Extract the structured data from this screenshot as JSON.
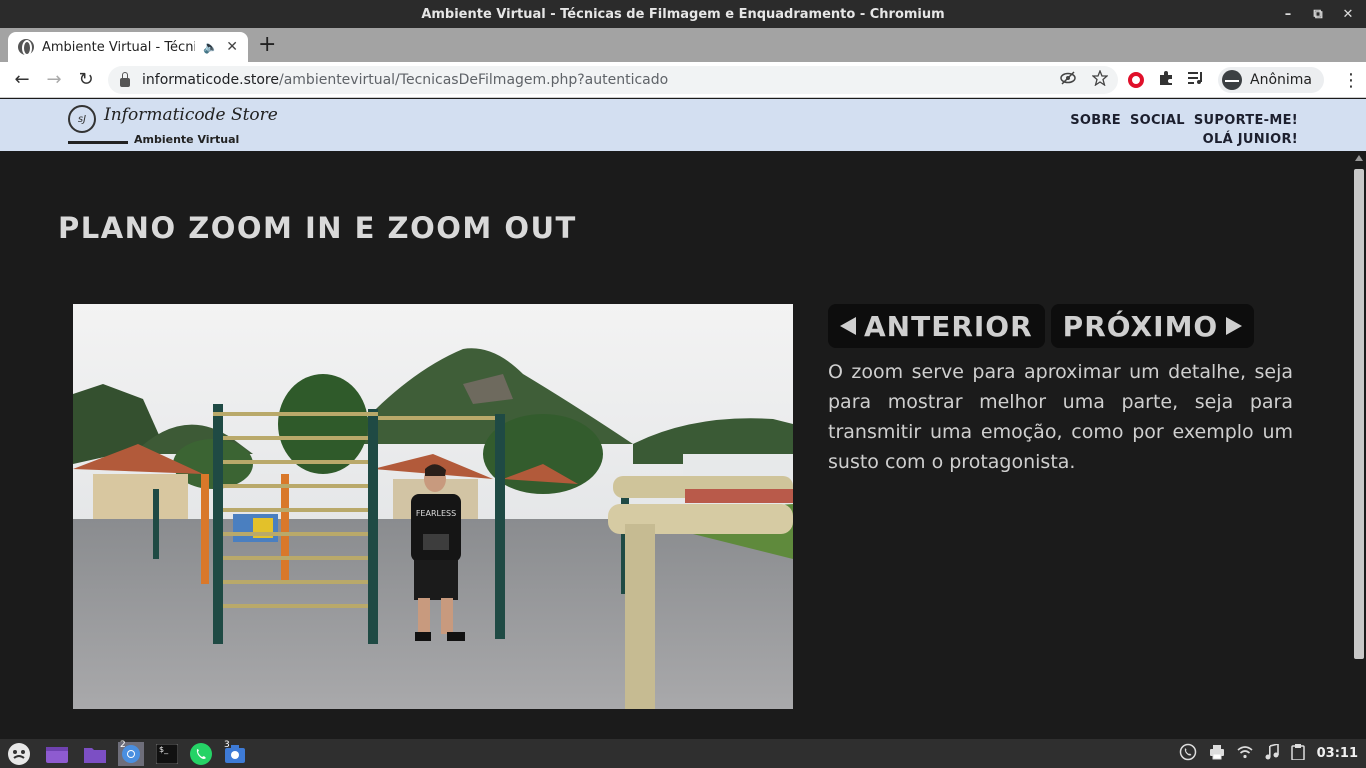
{
  "window": {
    "title": "Ambiente Virtual - Técnicas de Filmagem e Enquadramento - Chromium",
    "minimize": "–",
    "maximize": "⧉",
    "close": "✕"
  },
  "tab": {
    "title": "Ambiente Virtual - Técnica",
    "audio_icon": "🔈",
    "close": "✕",
    "new_tab": "+"
  },
  "toolbar": {
    "back": "←",
    "forward": "→",
    "reload": "↻",
    "url_host": "informaticode.store",
    "url_path": "/ambientevirtual/TecnicasDeFilmagem.php?autenticado",
    "profile_label": "Anônima"
  },
  "site": {
    "logo_mark": "sJ",
    "logo_name": "Informaticode Store",
    "logo_sub": "Ambiente Virtual",
    "nav": [
      "SOBRE",
      "SOCIAL",
      "SUPORTE-ME!"
    ],
    "greeting": "OLÁ JUNIOR!"
  },
  "content": {
    "title": "PLANO ZOOM IN E ZOOM OUT",
    "prev_label": "ANTERIOR",
    "next_label": "PRÓXIMO",
    "description": "O zoom serve para aproximar um detalhe, seja para mostrar melhor uma parte, seja para transmitir uma emoção, como por exemplo um susto com o protagonista.",
    "shirt_text": "FEARLESS"
  },
  "taskbar": {
    "chrome_badge": "2",
    "camera_badge": "3",
    "terminal_glyph": "$_",
    "clock": "03:11"
  },
  "colors": {
    "page_bg": "#1b1b1b",
    "header_bg": "#d3dff1",
    "text_light": "#cfcfcf",
    "title_color": "#d9d9d9",
    "button_bg": "#0d0d0d"
  }
}
